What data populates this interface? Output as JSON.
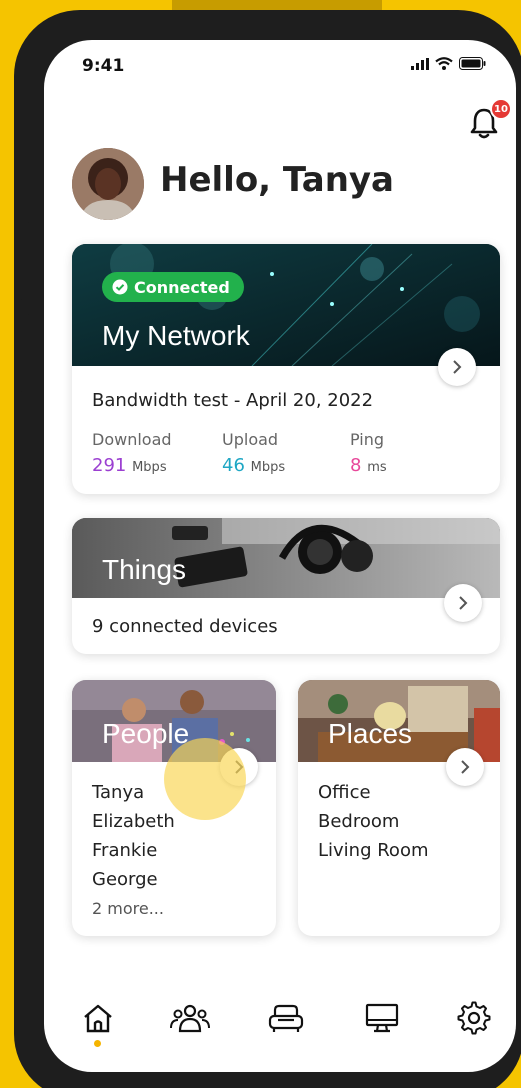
{
  "status_bar": {
    "time": "9:41"
  },
  "notifications": {
    "count": "10"
  },
  "greeting": "Hello, Tanya",
  "network_card": {
    "status": "Connected",
    "title": "My Network",
    "bandwidth_test": "Bandwidth test - April 20, 2022",
    "download": {
      "label": "Download",
      "value": "291",
      "unit": "Mbps",
      "color": "#9b3fd1"
    },
    "upload": {
      "label": "Upload",
      "value": "46",
      "unit": "Mbps",
      "color": "#1fa7c4"
    },
    "ping": {
      "label": "Ping",
      "value": "8",
      "unit": "ms",
      "color": "#e8489a"
    }
  },
  "things_card": {
    "title": "Things",
    "subtitle": "9 connected devices"
  },
  "people_card": {
    "title": "People",
    "items": [
      "Tanya",
      "Elizabeth",
      "Frankie",
      "George"
    ],
    "more": "2 more..."
  },
  "places_card": {
    "title": "Places",
    "items": [
      "Office",
      "Bedroom",
      "Living Room"
    ]
  },
  "nav": {
    "items": [
      "home-icon",
      "people-icon",
      "couch-icon",
      "monitor-icon",
      "gear-icon"
    ],
    "active": "home-icon",
    "accent": "#f5b400"
  },
  "colors": {
    "background": "#f5c400",
    "connected": "#22b14c",
    "badge": "#e53935"
  }
}
